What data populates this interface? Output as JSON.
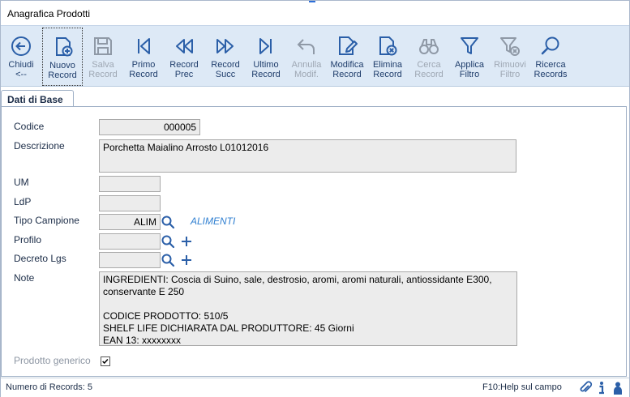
{
  "window": {
    "title": "Anagrafica Prodotti"
  },
  "toolbar": {
    "buttons": [
      {
        "line1": "Chiudi",
        "line2": "<--",
        "icon": "back-arrow-icon",
        "enabled": true
      },
      {
        "line1": "Nuovo",
        "line2": "Record",
        "icon": "new-document-icon",
        "enabled": true
      },
      {
        "line1": "Salva",
        "line2": "Record",
        "icon": "floppy-disk-icon",
        "enabled": false
      },
      {
        "line1": "Primo",
        "line2": "Record",
        "icon": "first-record-icon",
        "enabled": true
      },
      {
        "line1": "Record",
        "line2": "Prec",
        "icon": "previous-record-icon",
        "enabled": true
      },
      {
        "line1": "Record",
        "line2": "Succ",
        "icon": "next-record-icon",
        "enabled": true
      },
      {
        "line1": "Ultimo",
        "line2": "Record",
        "icon": "last-record-icon",
        "enabled": true
      },
      {
        "line1": "Annulla",
        "line2": "Modif.",
        "icon": "undo-arrow-icon",
        "enabled": false
      },
      {
        "line1": "Modifica",
        "line2": "Record",
        "icon": "edit-document-icon",
        "enabled": true
      },
      {
        "line1": "Elimina",
        "line2": "Record",
        "icon": "delete-document-icon",
        "enabled": true
      },
      {
        "line1": "Cerca",
        "line2": "Record",
        "icon": "binoculars-icon",
        "enabled": false
      },
      {
        "line1": "Applica",
        "line2": "Filtro",
        "icon": "funnel-icon",
        "enabled": true
      },
      {
        "line1": "Rimuovi",
        "line2": "Filtro",
        "icon": "funnel-remove-icon",
        "enabled": false
      },
      {
        "line1": "Ricerca",
        "line2": "Records",
        "icon": "magnifier-icon",
        "enabled": true
      }
    ]
  },
  "tabs": [
    {
      "label": "Dati di Base",
      "active": true
    }
  ],
  "form": {
    "codice": {
      "label": "Codice",
      "value": "000005"
    },
    "descrizione": {
      "label": "Descrizione",
      "value": "Porchetta Maialino Arrosto L01012016"
    },
    "um": {
      "label": "UM",
      "value": ""
    },
    "ldp": {
      "label": "LdP",
      "value": ""
    },
    "tipo_campione": {
      "label": "Tipo Campione",
      "value": "ALIM",
      "description": "ALIMENTI"
    },
    "profilo": {
      "label": "Profilo",
      "value": ""
    },
    "decreto_lgs": {
      "label": "Decreto Lgs",
      "value": ""
    },
    "note": {
      "label": "Note",
      "lines": [
        "INGREDIENTI: Coscia di Suino, sale, destrosio, aromi, aromi naturali, antiossidante E300, conservante E 250",
        "",
        "CODICE PRODOTTO: 510/5",
        "SHELF LIFE DICHIARATA DAL PRODUTTORE: 45 Giorni",
        "EAN 13: xxxxxxxx"
      ]
    },
    "prodotto_generico": {
      "label": "Prodotto generico",
      "checked": true
    }
  },
  "status": {
    "records": "Numero di Records: 5",
    "help": "F10:Help sul campo"
  },
  "colors": {
    "toolbar_bg": "#dde9f6",
    "icon": "#2b5fa8",
    "disabled_icon": "#8f99a6",
    "link": "#2f7fd1"
  }
}
